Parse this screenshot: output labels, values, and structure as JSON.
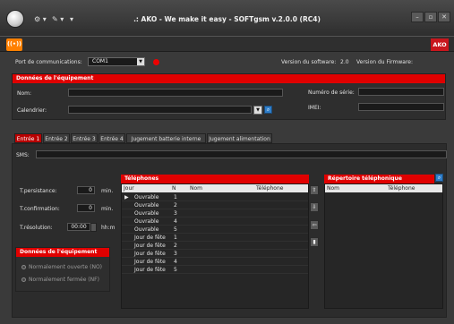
{
  "window": {
    "title": ".: AKO - We make it easy - SOFTgsm v.2.0.0 (RC4)",
    "quick_access": [
      "⚙ ▾",
      "✎ ▾",
      "▾"
    ],
    "controls": [
      "–",
      "▫",
      "✕"
    ]
  },
  "ribbon": {
    "signal_label": "((•))",
    "logo": "AKO"
  },
  "top": {
    "port_label": "Port de communications:",
    "port_value": "COM1",
    "software_version_label": "Version du software:",
    "software_version": "2.0",
    "firmware_version_label": "Version du Firmware:"
  },
  "equipment": {
    "header": "Données de l'équipement",
    "nom_label": "Nom:",
    "calendrier_label": "Calendrier:",
    "serial_label": "Numéro de série:",
    "imei_label": "IMEI:"
  },
  "tabs": [
    "Entrée 1",
    "Entrée 2",
    "Entrée 3",
    "Entrée 4",
    "Jugement batterie interne",
    "Jugement alimentation"
  ],
  "sms_label": "SMS:",
  "timers": [
    {
      "label": "T.persistance:",
      "value": "0",
      "unit": "min."
    },
    {
      "label": "T.confirmation:",
      "value": "0",
      "unit": "min."
    },
    {
      "label": "T.résolution:",
      "value": "00:00",
      "unit": "hh:m"
    }
  ],
  "equipment2": {
    "header": "Données de l'équipement",
    "options": [
      "Normalement ouverte (NO)",
      "Normalement fermée (NF)"
    ]
  },
  "telephones": {
    "header": "Téléphones",
    "columns": [
      "Jour",
      "N",
      "Nom",
      "Téléphone"
    ],
    "rows": [
      {
        "jour": "Ouvrable",
        "n": "1",
        "selected": true
      },
      {
        "jour": "Ouvrable",
        "n": "2"
      },
      {
        "jour": "Ouvrable",
        "n": "3"
      },
      {
        "jour": "Ouvrable",
        "n": "4"
      },
      {
        "jour": "Ouvrable",
        "n": "5"
      },
      {
        "jour": "Jour de fête",
        "n": "1"
      },
      {
        "jour": "Jour de fête",
        "n": "2"
      },
      {
        "jour": "Jour de fête",
        "n": "3"
      },
      {
        "jour": "Jour de fête",
        "n": "4"
      },
      {
        "jour": "Jour de fête",
        "n": "5"
      }
    ]
  },
  "repertoire": {
    "header": "Répertoire téléphonique",
    "columns": [
      "Nom",
      "Téléphone"
    ]
  },
  "side_buttons": [
    "⇧",
    "⇩",
    "⇦",
    "▮"
  ],
  "colors": {
    "accent_red": "#e00000",
    "dark_bg": "#3a3a3a"
  }
}
